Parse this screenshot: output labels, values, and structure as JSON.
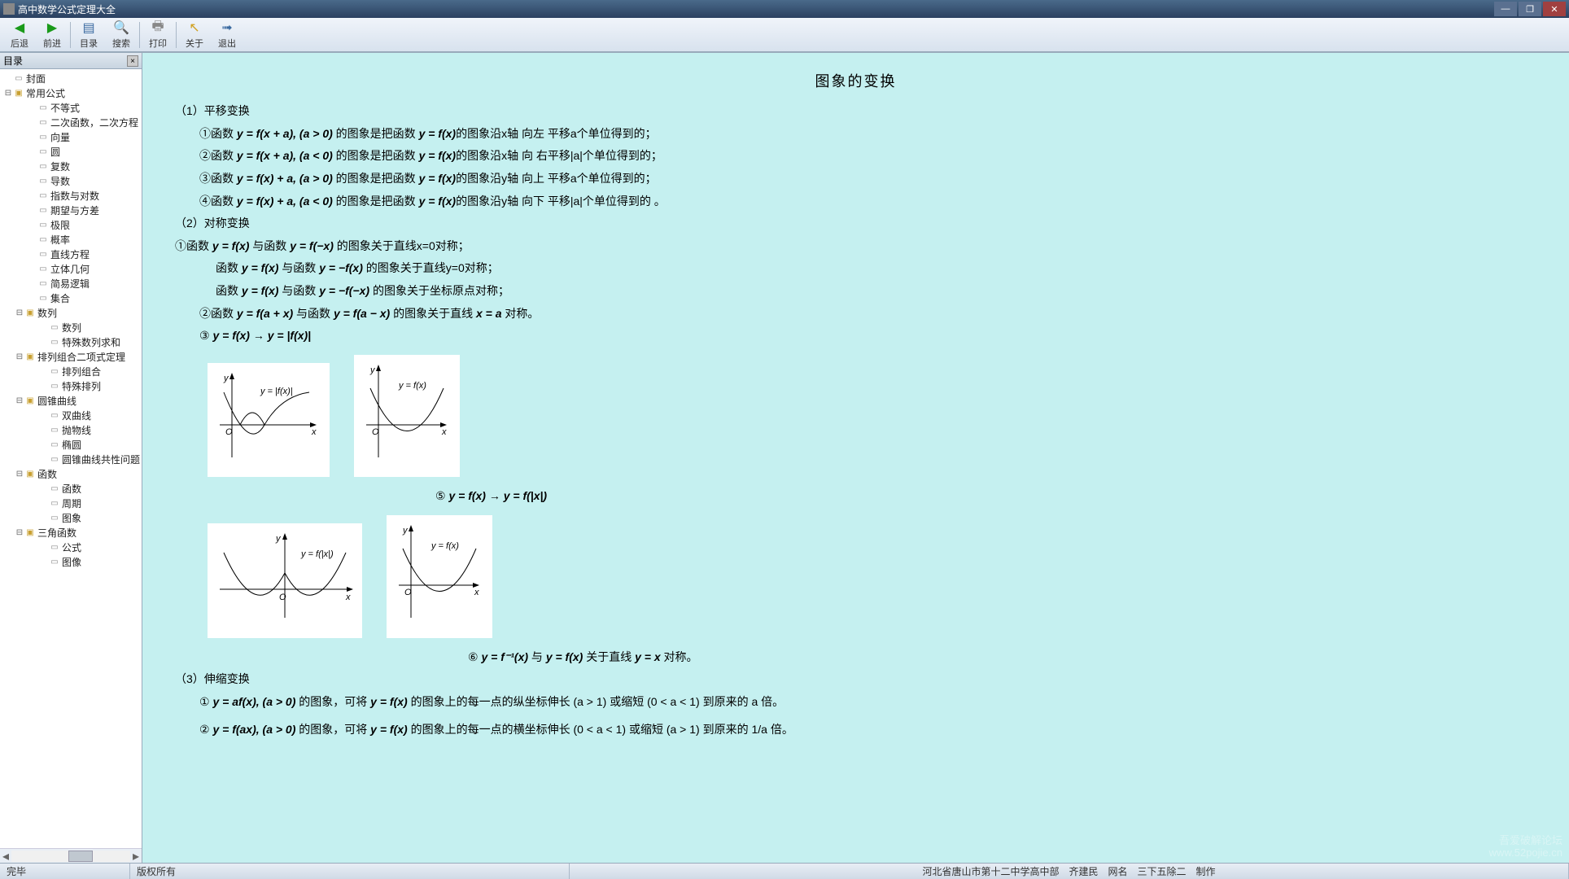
{
  "window": {
    "title": "高中数学公式定理大全"
  },
  "winbtns": {
    "min": "—",
    "max": "❐",
    "close": "✕"
  },
  "toolbar": {
    "back": "后退",
    "forward": "前进",
    "catalog": "目录",
    "search": "搜索",
    "print": "打印",
    "about": "关于",
    "exit": "退出"
  },
  "sidebar": {
    "header": "目录",
    "tree": {
      "cover": "封面",
      "common": "常用公式",
      "common_children": [
        "不等式",
        "二次函数，二次方程",
        "向量",
        "圆",
        "复数",
        "导数",
        "指数与对数",
        "期望与方差",
        "极限",
        "概率",
        "直线方程",
        "立体几何",
        "简易逻辑",
        "集合"
      ],
      "seq": "数列",
      "seq_children": [
        "数列",
        "特殊数列求和"
      ],
      "permcomb": "排列组合二项式定理",
      "permcomb_children": [
        "排列组合",
        "特殊排列"
      ],
      "conic": "圆锥曲线",
      "conic_children": [
        "双曲线",
        "抛物线",
        "椭圆",
        "圆锥曲线共性问题"
      ],
      "func": "函数",
      "func_children": [
        "函数",
        "周期",
        "图象"
      ],
      "trig": "三角函数",
      "trig_children": [
        "公式",
        "图像"
      ]
    }
  },
  "content": {
    "title": "图象的变换",
    "sec1": "（1）平移变换",
    "s1a": "①函数 ",
    "s1af": "y = f(x + a), (a > 0)",
    "s1am": " 的图象是把函数 ",
    "s1ay": "y = f(x)",
    "s1ae": "的图象沿x轴 向左 平移a个单位得到的；",
    "s1b": "②函数 ",
    "s1bf": "y = f(x + a), (a < 0)",
    "s1bm": " 的图象是把函数 ",
    "s1by": "y = f(x)",
    "s1be": "的图象沿x轴 向 右平移|a|个单位得到的；",
    "s1c": "③函数 ",
    "s1cf": "y = f(x) + a, (a > 0)",
    "s1cm": " 的图象是把函数 ",
    "s1cy": "y = f(x)",
    "s1ce": "的图象沿y轴 向上 平移a个单位得到的；",
    "s1d": "④函数 ",
    "s1df": "y = f(x) + a, (a < 0)",
    "s1dm": " 的图象是把函数 ",
    "s1dy": "y = f(x)",
    "s1de": "的图象沿y轴 向下 平移|a|个单位得到的 。",
    "sec2": "（2）对称变换",
    "s2a": "①函数 ",
    "s2af": "y = f(x)",
    "s2am": " 与函数 ",
    "s2ag": "y = f(−x)",
    "s2ae": " 的图象关于直线x=0对称；",
    "s2b_pre": "函数 ",
    "s2bf": "y = f(x)",
    "s2bm": " 与函数 ",
    "s2bg": "y = −f(x)",
    "s2be": " 的图象关于直线y=0对称；",
    "s2c_pre": "函数 ",
    "s2cf": "y = f(x)",
    "s2cm": " 与函数 ",
    "s2cg": "y = −f(−x)",
    "s2ce": " 的图象关于坐标原点对称；",
    "s2d": "②函数 ",
    "s2df": "y = f(a + x)",
    "s2dm": " 与函数 ",
    "s2dg": "y = f(a − x)",
    "s2de": " 的图象关于直线 ",
    "s2dx": "x = a",
    "s2de2": " 对称。",
    "s2e": "③ ",
    "s2ef": "y = f(x) → y = |f(x)|",
    "note5": "⑤ ",
    "note5f": "y = f(x) → y = f(|x|)",
    "note6": "⑥ ",
    "note6a": "y = f⁻¹(x)",
    "note6m": " 与 ",
    "note6b": "y = f(x)",
    "note6e": " 关于直线 ",
    "note6l": "y = x",
    "note6e2": " 对称。",
    "sec3": "（3）伸缩变换",
    "s3a": "① ",
    "s3af": "y = af(x), (a > 0)",
    "s3am": " 的图象，可将 ",
    "s3ay": "y = f(x)",
    "s3ae": " 的图象上的每一点的纵坐标伸长 (a > 1) 或缩短 (0 < a < 1) 到原来的 a 倍。",
    "s3b": "② ",
    "s3bf": "y = f(ax), (a > 0)",
    "s3bm": " 的图象，可将 ",
    "s3by": "y = f(x)",
    "s3be": " 的图象上的每一点的横坐标伸长 (0 < a < 1) 或缩短 (a > 1) 到原来的 1/a 倍。",
    "g1_label": "y = |f(x)|",
    "g2_label": "y = f(x)",
    "g3_label": "y = f(|x|)",
    "g4_label": "y = f(x)"
  },
  "status": {
    "left": "完毕",
    "copyright": "版权所有",
    "author": "河北省唐山市第十二中学高中部　齐建民　网名　三下五除二　制作"
  },
  "watermark": {
    "l1": "吾爱破解论坛",
    "l2": "www.52pojie.cn"
  }
}
